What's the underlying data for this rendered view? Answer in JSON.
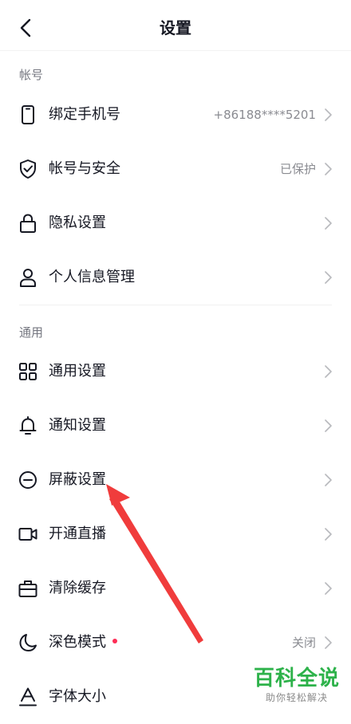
{
  "header": {
    "title": "设置"
  },
  "sections": [
    {
      "title": "帐号"
    },
    {
      "title": "通用"
    }
  ],
  "rows": [
    {
      "label": "绑定手机号",
      "value": "+86188****5201",
      "icon": "phone-icon"
    },
    {
      "label": "帐号与安全",
      "value": "已保护",
      "icon": "shield-icon"
    },
    {
      "label": "隐私设置",
      "value": "",
      "icon": "lock-icon"
    },
    {
      "label": "个人信息管理",
      "value": "",
      "icon": "person-icon"
    },
    {
      "label": "通用设置",
      "value": "",
      "icon": "grid-icon"
    },
    {
      "label": "通知设置",
      "value": "",
      "icon": "bell-icon"
    },
    {
      "label": "屏蔽设置",
      "value": "",
      "icon": "block-icon"
    },
    {
      "label": "开通直播",
      "value": "",
      "icon": "video-icon"
    },
    {
      "label": "清除缓存",
      "value": "",
      "icon": "briefcase-icon"
    },
    {
      "label": "深色模式",
      "value": "关闭",
      "icon": "moon-icon",
      "badge_color": "#fe2c55"
    },
    {
      "label": "字体大小",
      "value": "",
      "icon": "font-icon"
    }
  ],
  "annotation": {
    "color": "#f03c3c",
    "points_to": "屏蔽设置"
  },
  "watermark": {
    "main": "百科全说",
    "sub": "助你轻松解决",
    "color": "#2db24a"
  }
}
